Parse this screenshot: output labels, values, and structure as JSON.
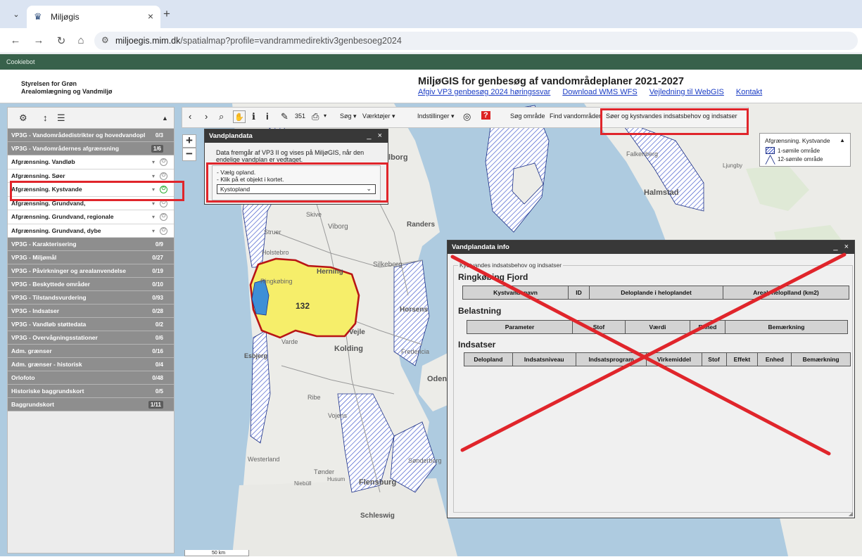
{
  "browser": {
    "tab_title": "Miljøgis",
    "url_host": "miljoegis.mim.dk",
    "url_path": "/spatialmap?profile=vandrammedirektiv3genbesoeg2024"
  },
  "cookiebar": {
    "label": "Cookiebot"
  },
  "header": {
    "agency_line1": "Styrelsen for Grøn",
    "agency_line2": "Arealomlægning og Vandmiljø",
    "title": "MiljøGIS for genbesøg af vandområdeplaner 2021-2027",
    "links": [
      "Afgiv VP3 genbesøg 2024 høringssvar",
      "Download WMS WFS",
      "Vejledning til WebGIS",
      "Kontakt"
    ]
  },
  "layers": [
    {
      "label": "VP3G - Vandområdedistrikter og hovedvandopl",
      "count": "0/3",
      "type": "group"
    },
    {
      "label": "VP3G - Vandområdernes afgrænsning",
      "count": "1/6",
      "type": "group",
      "boxed": true
    },
    {
      "label": "Afgrænsning. Vandløb",
      "type": "sub"
    },
    {
      "label": "Afgrænsning. Søer",
      "type": "sub"
    },
    {
      "label": "Afgrænsning. Kystvande",
      "type": "sub",
      "on": true
    },
    {
      "label": "Afgrænsning. Grundvand,",
      "type": "sub"
    },
    {
      "label": "Afgrænsning. Grundvand, regionale",
      "type": "sub"
    },
    {
      "label": "Afgrænsning. Grundvand, dybe",
      "type": "sub"
    },
    {
      "label": "VP3G - Karakterisering",
      "count": "0/9",
      "type": "group"
    },
    {
      "label": "VP3G - Miljømål",
      "count": "0/27",
      "type": "group"
    },
    {
      "label": "VP3G - Påvirkninger og arealanvendelse",
      "count": "0/19",
      "type": "group"
    },
    {
      "label": "VP3G - Beskyttede områder",
      "count": "0/10",
      "type": "group"
    },
    {
      "label": "VP3G - Tilstandsvurdering",
      "count": "0/93",
      "type": "group"
    },
    {
      "label": "VP3G - Indsatser",
      "count": "0/28",
      "type": "group"
    },
    {
      "label": "VP3G - Vandløb støttedata",
      "count": "0/2",
      "type": "group"
    },
    {
      "label": "VP3G - Overvågningsstationer",
      "count": "0/6",
      "type": "group"
    },
    {
      "label": "Adm. grænser",
      "count": "0/16",
      "type": "group"
    },
    {
      "label": "Adm. grænser - historisk",
      "count": "0/4",
      "type": "group"
    },
    {
      "label": "Orlofoto",
      "count": "0/48",
      "type": "group"
    },
    {
      "label": "Historiske baggrundskort",
      "count": "0/5",
      "type": "group"
    },
    {
      "label": "Baggrundskort",
      "count": "1/11",
      "type": "group",
      "boxed": true
    }
  ],
  "toolbar": {
    "search_menu": "Søg",
    "tools_menu": "Værktøjer",
    "settings_menu": "Indstillinger",
    "search_area": "Søg område",
    "find_waters": "Find vandområder",
    "lakes_coastal": "Søer og kystvandes indsatsbehov og indsatser",
    "measure_label": "351"
  },
  "vandplandata": {
    "title": "Vandplandata",
    "controls": "_ ×",
    "text": "Data fremgår af VP3 II og vises på MiljøGIS, når den endelige vandplan er vedtaget.",
    "step1": "- Vælg opland.",
    "step2": "- Klik på et objekt i kortet.",
    "select_value": "Kystopland"
  },
  "info": {
    "title": "Vandplandata info",
    "controls": "_ ×",
    "fieldset_label": "Kystvandes indsatsbehov og indsatser",
    "waterbody": "Ringkøbing Fjord",
    "table1_headers": [
      "Kystvandsnavn",
      "ID",
      "Delоplande i heloplandet",
      "Areal, heloplland (km2)"
    ],
    "section2": "Belastning",
    "table2_headers": [
      "Parameter",
      "Stof",
      "Værdi",
      "Enhed",
      "Bemærkning"
    ],
    "section3": "Indsatser",
    "table3_headers": [
      "Delopland",
      "Indsatsniveau",
      "Indsatsprogram",
      "Virkemiddel",
      "Stof",
      "Effekt",
      "Enhed",
      "Bemærkning"
    ]
  },
  "legend": {
    "title": "Afgrænsning. Kystvande",
    "items": [
      "1-sømile område",
      "12-sømile område"
    ]
  },
  "map_labels": [
    "Aalborg",
    "Falkenberg",
    "Ljungby",
    "Halmstad",
    "Skive",
    "Viborg",
    "Randers",
    "Struer",
    "Holstebro",
    "Herning",
    "Silkeborg",
    "Ringkøbing",
    "Horsens",
    "Vejle",
    "Varde",
    "Kolding",
    "Esbjerg",
    "Fredericia",
    "Odense",
    "Ribe",
    "Vojens",
    "Tønder",
    "Westerland",
    "Niebüll",
    "Husum",
    "Flensburg",
    "Schleswig",
    "Sønderborg"
  ],
  "catchment_label": "132",
  "scale_label": "50 km"
}
